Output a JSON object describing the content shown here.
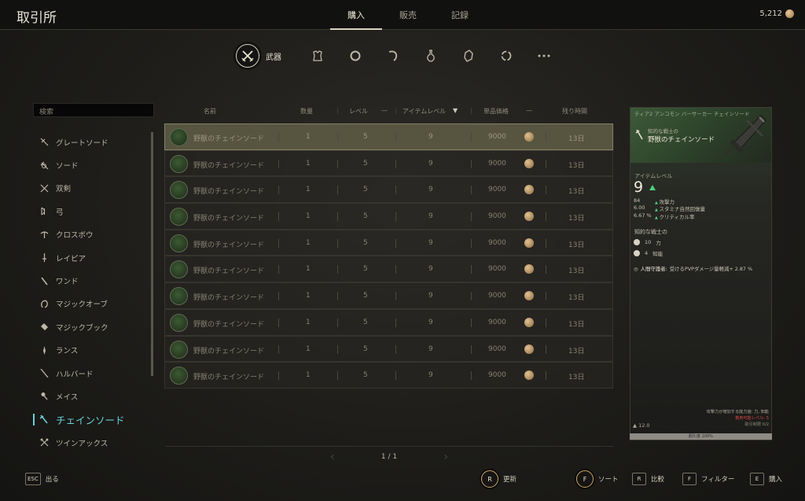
{
  "app_title": "取引所",
  "main_tabs": [
    {
      "label": "購入",
      "active": true
    },
    {
      "label": "販売",
      "active": false
    },
    {
      "label": "記録",
      "active": false
    }
  ],
  "currency": {
    "amount": "5,212",
    "icon": "coin-icon"
  },
  "category_bar": {
    "active_label": "武器",
    "icons": [
      "crossed-swords-icon",
      "armor-icon",
      "ring-icon",
      "hook-icon",
      "potion-icon",
      "crystal-icon",
      "recycle-icon",
      "more-icon"
    ]
  },
  "search": {
    "placeholder": "検索"
  },
  "sidebar": {
    "items": [
      {
        "label": "グレートソード",
        "icon": "greatsword-icon"
      },
      {
        "label": "ソード",
        "icon": "sword-icon"
      },
      {
        "label": "双剣",
        "icon": "dual-blades-icon"
      },
      {
        "label": "弓",
        "icon": "bow-icon"
      },
      {
        "label": "クロスボウ",
        "icon": "crossbow-icon"
      },
      {
        "label": "レイピア",
        "icon": "rapier-icon"
      },
      {
        "label": "ワンド",
        "icon": "wand-icon"
      },
      {
        "label": "マジックオーブ",
        "icon": "orb-icon"
      },
      {
        "label": "マジックブック",
        "icon": "book-icon"
      },
      {
        "label": "ランス",
        "icon": "lance-icon"
      },
      {
        "label": "ハルバード",
        "icon": "halberd-icon"
      },
      {
        "label": "メイス",
        "icon": "mace-icon"
      },
      {
        "label": "チェインソード",
        "icon": "chainsword-icon",
        "active": true
      },
      {
        "label": "ツインアックス",
        "icon": "twin-axe-icon"
      }
    ]
  },
  "table": {
    "headers": {
      "name": "名前",
      "qty": "数量",
      "level": "レベル",
      "item_level": "アイテムレベル",
      "unit_price": "単品価格",
      "time_left": "残り時間"
    },
    "rows": [
      {
        "name": "野獣のチェインソード",
        "qty": "1",
        "level": "5",
        "item_level": "9",
        "price": "9000",
        "time": "13日"
      },
      {
        "name": "野獣のチェインソード",
        "qty": "1",
        "level": "5",
        "item_level": "9",
        "price": "9000",
        "time": "13日"
      },
      {
        "name": "野獣のチェインソード",
        "qty": "1",
        "level": "5",
        "item_level": "9",
        "price": "9000",
        "time": "13日"
      },
      {
        "name": "野獣のチェインソード",
        "qty": "1",
        "level": "5",
        "item_level": "9",
        "price": "9000",
        "time": "13日"
      },
      {
        "name": "野獣のチェインソード",
        "qty": "1",
        "level": "5",
        "item_level": "9",
        "price": "9000",
        "time": "13日"
      },
      {
        "name": "野獣のチェインソード",
        "qty": "1",
        "level": "5",
        "item_level": "9",
        "price": "9000",
        "time": "13日"
      },
      {
        "name": "野獣のチェインソード",
        "qty": "1",
        "level": "5",
        "item_level": "9",
        "price": "9000",
        "time": "13日"
      },
      {
        "name": "野獣のチェインソード",
        "qty": "1",
        "level": "5",
        "item_level": "9",
        "price": "9000",
        "time": "13日"
      },
      {
        "name": "野獣のチェインソード",
        "qty": "1",
        "level": "5",
        "item_level": "9",
        "price": "9000",
        "time": "13日"
      },
      {
        "name": "野獣のチェインソード",
        "qty": "1",
        "level": "5",
        "item_level": "9",
        "price": "9000",
        "time": "13日"
      }
    ],
    "pagination": "1 / 1"
  },
  "detail": {
    "tags": "ティア2  アンコモン  バーサーカー  チェインソード",
    "subtitle": "知的な戦士の",
    "name": "野獣のチェインソード",
    "item_level_label": "アイテムレベル",
    "item_level": "9",
    "stats": [
      {
        "value": "84",
        "label": "攻撃力"
      },
      {
        "value": "6.00",
        "label": "スタミナ自然回復量"
      },
      {
        "value": "6.67 %",
        "label": "クリティカル率"
      }
    ],
    "section_title": "知的な戦士の",
    "attributes": [
      {
        "value": "10",
        "label": "力"
      },
      {
        "value": "4",
        "label": "知能"
      }
    ],
    "special_label": "人間守護者:",
    "special_text": "受けるPVPダメージ量軽減+ 2.87 %",
    "footer_line1": "攻撃力が増加する能力値: 力, 知能",
    "footer_line2": "着用可能レベル: 5",
    "footer_line3": "取引制限 0/2",
    "weight": "12.0",
    "durability_label": "耐久度 100%",
    "durability": 1.0
  },
  "footer_keys": [
    {
      "key": "ESC",
      "label": "出る"
    },
    {
      "key": "R",
      "label": "更新"
    },
    {
      "key": "F",
      "label": "ソート"
    },
    {
      "key": "R",
      "label": "比較"
    },
    {
      "key": "F",
      "label": "フィルター"
    },
    {
      "key": "E",
      "label": "購入"
    }
  ],
  "colors": {
    "accent": "#6ad0d5",
    "selected_row": "#57553f",
    "stat_up": "#4fcf7c",
    "warning": "#d64545"
  }
}
